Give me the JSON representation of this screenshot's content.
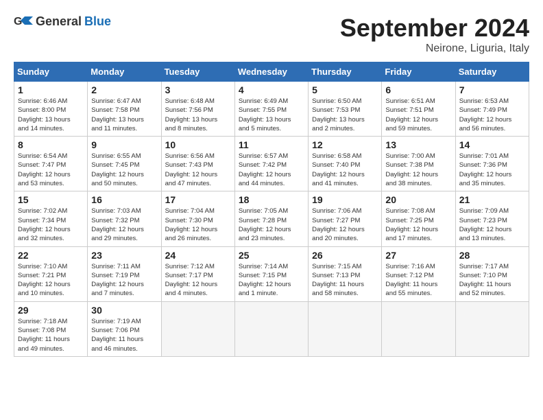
{
  "header": {
    "logo_general": "General",
    "logo_blue": "Blue",
    "month_title": "September 2024",
    "location": "Neirone, Liguria, Italy"
  },
  "columns": [
    "Sunday",
    "Monday",
    "Tuesday",
    "Wednesday",
    "Thursday",
    "Friday",
    "Saturday"
  ],
  "weeks": [
    [
      {
        "day": "1",
        "info": "Sunrise: 6:46 AM\nSunset: 8:00 PM\nDaylight: 13 hours\nand 14 minutes."
      },
      {
        "day": "2",
        "info": "Sunrise: 6:47 AM\nSunset: 7:58 PM\nDaylight: 13 hours\nand 11 minutes."
      },
      {
        "day": "3",
        "info": "Sunrise: 6:48 AM\nSunset: 7:56 PM\nDaylight: 13 hours\nand 8 minutes."
      },
      {
        "day": "4",
        "info": "Sunrise: 6:49 AM\nSunset: 7:55 PM\nDaylight: 13 hours\nand 5 minutes."
      },
      {
        "day": "5",
        "info": "Sunrise: 6:50 AM\nSunset: 7:53 PM\nDaylight: 13 hours\nand 2 minutes."
      },
      {
        "day": "6",
        "info": "Sunrise: 6:51 AM\nSunset: 7:51 PM\nDaylight: 12 hours\nand 59 minutes."
      },
      {
        "day": "7",
        "info": "Sunrise: 6:53 AM\nSunset: 7:49 PM\nDaylight: 12 hours\nand 56 minutes."
      }
    ],
    [
      {
        "day": "8",
        "info": "Sunrise: 6:54 AM\nSunset: 7:47 PM\nDaylight: 12 hours\nand 53 minutes."
      },
      {
        "day": "9",
        "info": "Sunrise: 6:55 AM\nSunset: 7:45 PM\nDaylight: 12 hours\nand 50 minutes."
      },
      {
        "day": "10",
        "info": "Sunrise: 6:56 AM\nSunset: 7:43 PM\nDaylight: 12 hours\nand 47 minutes."
      },
      {
        "day": "11",
        "info": "Sunrise: 6:57 AM\nSunset: 7:42 PM\nDaylight: 12 hours\nand 44 minutes."
      },
      {
        "day": "12",
        "info": "Sunrise: 6:58 AM\nSunset: 7:40 PM\nDaylight: 12 hours\nand 41 minutes."
      },
      {
        "day": "13",
        "info": "Sunrise: 7:00 AM\nSunset: 7:38 PM\nDaylight: 12 hours\nand 38 minutes."
      },
      {
        "day": "14",
        "info": "Sunrise: 7:01 AM\nSunset: 7:36 PM\nDaylight: 12 hours\nand 35 minutes."
      }
    ],
    [
      {
        "day": "15",
        "info": "Sunrise: 7:02 AM\nSunset: 7:34 PM\nDaylight: 12 hours\nand 32 minutes."
      },
      {
        "day": "16",
        "info": "Sunrise: 7:03 AM\nSunset: 7:32 PM\nDaylight: 12 hours\nand 29 minutes."
      },
      {
        "day": "17",
        "info": "Sunrise: 7:04 AM\nSunset: 7:30 PM\nDaylight: 12 hours\nand 26 minutes."
      },
      {
        "day": "18",
        "info": "Sunrise: 7:05 AM\nSunset: 7:28 PM\nDaylight: 12 hours\nand 23 minutes."
      },
      {
        "day": "19",
        "info": "Sunrise: 7:06 AM\nSunset: 7:27 PM\nDaylight: 12 hours\nand 20 minutes."
      },
      {
        "day": "20",
        "info": "Sunrise: 7:08 AM\nSunset: 7:25 PM\nDaylight: 12 hours\nand 17 minutes."
      },
      {
        "day": "21",
        "info": "Sunrise: 7:09 AM\nSunset: 7:23 PM\nDaylight: 12 hours\nand 13 minutes."
      }
    ],
    [
      {
        "day": "22",
        "info": "Sunrise: 7:10 AM\nSunset: 7:21 PM\nDaylight: 12 hours\nand 10 minutes."
      },
      {
        "day": "23",
        "info": "Sunrise: 7:11 AM\nSunset: 7:19 PM\nDaylight: 12 hours\nand 7 minutes."
      },
      {
        "day": "24",
        "info": "Sunrise: 7:12 AM\nSunset: 7:17 PM\nDaylight: 12 hours\nand 4 minutes."
      },
      {
        "day": "25",
        "info": "Sunrise: 7:14 AM\nSunset: 7:15 PM\nDaylight: 12 hours\nand 1 minute."
      },
      {
        "day": "26",
        "info": "Sunrise: 7:15 AM\nSunset: 7:13 PM\nDaylight: 11 hours\nand 58 minutes."
      },
      {
        "day": "27",
        "info": "Sunrise: 7:16 AM\nSunset: 7:12 PM\nDaylight: 11 hours\nand 55 minutes."
      },
      {
        "day": "28",
        "info": "Sunrise: 7:17 AM\nSunset: 7:10 PM\nDaylight: 11 hours\nand 52 minutes."
      }
    ],
    [
      {
        "day": "29",
        "info": "Sunrise: 7:18 AM\nSunset: 7:08 PM\nDaylight: 11 hours\nand 49 minutes."
      },
      {
        "day": "30",
        "info": "Sunrise: 7:19 AM\nSunset: 7:06 PM\nDaylight: 11 hours\nand 46 minutes."
      },
      null,
      null,
      null,
      null,
      null
    ]
  ]
}
